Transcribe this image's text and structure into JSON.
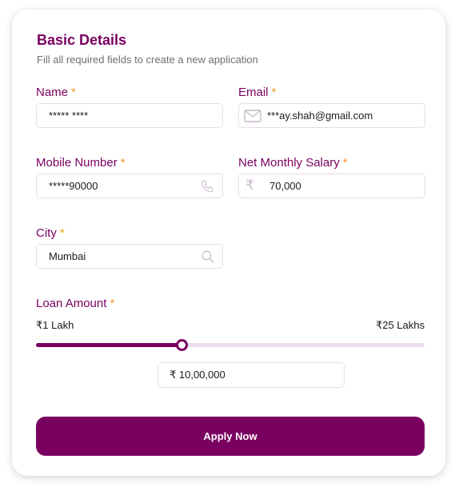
{
  "form": {
    "title": "Basic Details",
    "subtitle": "Fill all required fields to create a new application",
    "required_marker": "*"
  },
  "fields": {
    "name": {
      "label": "Name",
      "value": "***** ****"
    },
    "email": {
      "label": "Email",
      "value": "***ay.shah@gmail.com",
      "icon": "mail-icon"
    },
    "mobile": {
      "label": "Mobile Number",
      "value": "*****90000",
      "icon": "phone-icon"
    },
    "salary": {
      "label": "Net Monthly Salary",
      "value": "70,000",
      "icon": "rupee-icon",
      "prefix": "₹"
    },
    "city": {
      "label": "City",
      "value": "Mumbai",
      "icon": "search-icon"
    }
  },
  "loan": {
    "label": "Loan Amount",
    "min_label": "₹1 Lakh",
    "max_label": "₹25 Lakhs",
    "min_lakhs": 1,
    "max_lakhs": 25,
    "value_lakhs": 10,
    "value_display": "₹ 10,00,000"
  },
  "actions": {
    "apply_label": "Apply Now"
  },
  "colors": {
    "brand": "#7a0060",
    "required": "#f29a1c",
    "track": "#efdcef",
    "border": "#e6dde8",
    "icon": "#c9b8cc"
  }
}
